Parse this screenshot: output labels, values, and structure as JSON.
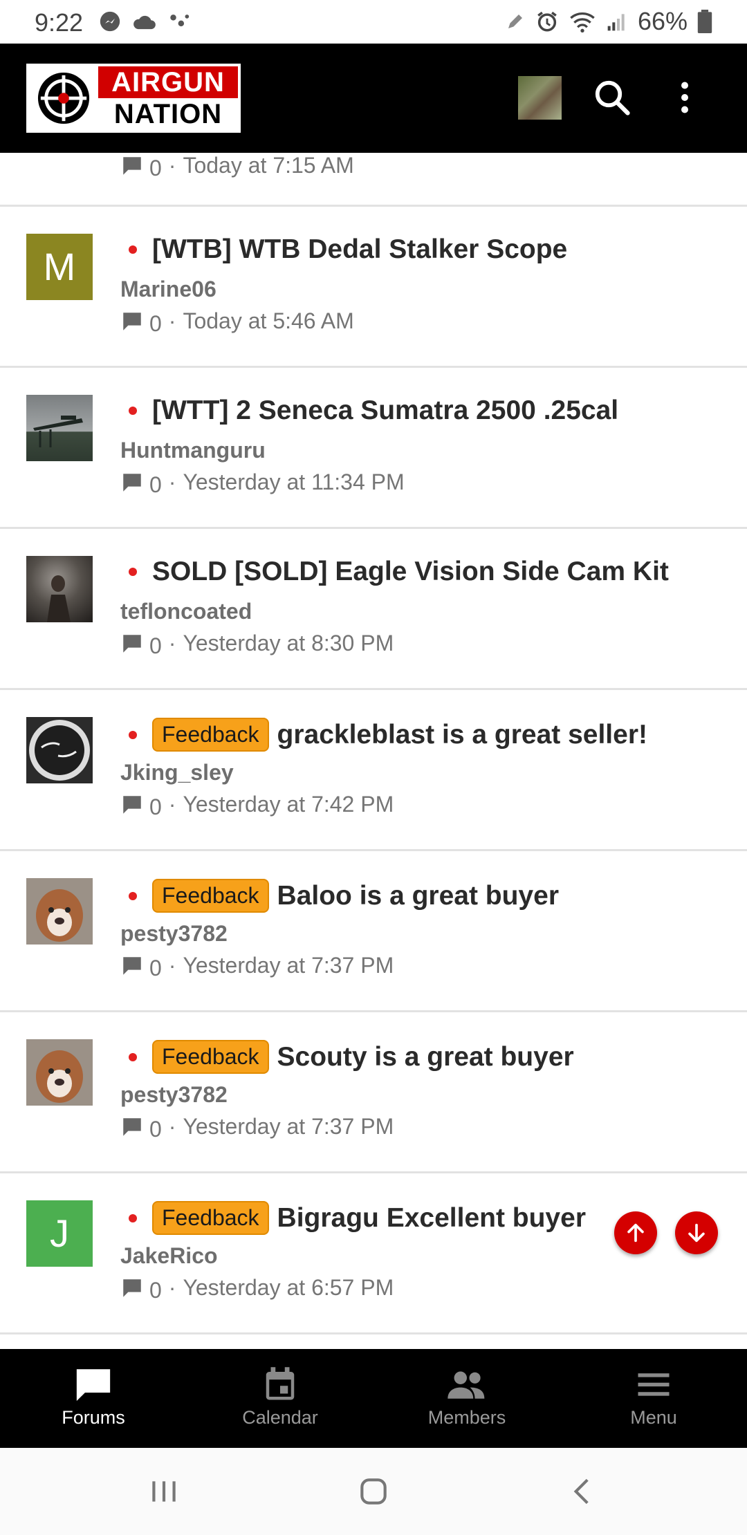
{
  "status_bar": {
    "time": "9:22",
    "battery": "66%"
  },
  "app": {
    "logo_line1": "AIRGUN",
    "logo_line2": "NATION",
    "colors": {
      "brand_red": "#d10000",
      "unread_dot": "#e32020",
      "prefix_orange": "#f7a11a"
    }
  },
  "partial_thread": {
    "replies": "0",
    "time": "Today at 7:15 AM"
  },
  "threads": [
    {
      "avatar_letter": "M",
      "avatar_color": "#8b8621",
      "prefix": "",
      "title": "[WTB] WTB Dedal Stalker Scope",
      "author": "Marine06",
      "replies": "0",
      "time": "Today at 5:46 AM"
    },
    {
      "avatar_letter": "",
      "prefix": "",
      "title": "[WTT] 2 Seneca Sumatra 2500 .25cal",
      "author": "Huntmanguru",
      "replies": "0",
      "time": "Yesterday at 11:34 PM"
    },
    {
      "avatar_letter": "",
      "prefix": "",
      "title": "SOLD [SOLD] Eagle Vision Side Cam Kit",
      "author": "tefloncoated",
      "replies": "0",
      "time": "Yesterday at 8:30 PM"
    },
    {
      "avatar_letter": "",
      "prefix": "Feedback",
      "title": "grackleblast is a great seller!",
      "author": "Jking_sley",
      "replies": "0",
      "time": "Yesterday at 7:42 PM"
    },
    {
      "avatar_letter": "",
      "prefix": "Feedback",
      "title": "Baloo is a great buyer",
      "author": "pesty3782",
      "replies": "0",
      "time": "Yesterday at 7:37 PM"
    },
    {
      "avatar_letter": "",
      "prefix": "Feedback",
      "title": "Scouty is a great buyer",
      "author": "pesty3782",
      "replies": "0",
      "time": "Yesterday at 7:37 PM"
    },
    {
      "avatar_letter": "J",
      "avatar_color": "#4caf50",
      "prefix": "Feedback",
      "title": "Bigragu Excellent buyer",
      "author": "JakeRico",
      "replies": "0",
      "time": "Yesterday at 6:57 PM"
    }
  ],
  "bottom_nav": [
    {
      "label": "Forums",
      "icon": "forums-icon",
      "active": true
    },
    {
      "label": "Calendar",
      "icon": "calendar-icon",
      "active": false
    },
    {
      "label": "Members",
      "icon": "members-icon",
      "active": false
    },
    {
      "label": "Menu",
      "icon": "menu-icon",
      "active": false
    }
  ]
}
